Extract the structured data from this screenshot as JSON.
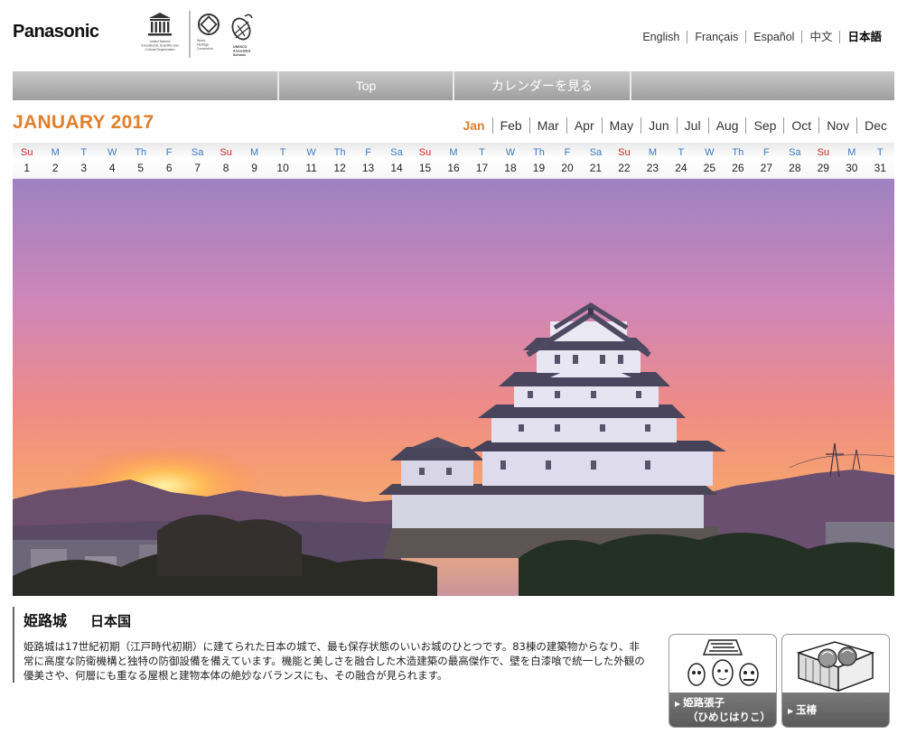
{
  "header": {
    "brand": "Panasonic",
    "unesco": {
      "line1": "United Nations",
      "line2": "Educational, Scientific and",
      "line3": "Cultural Organization",
      "whc1": "World",
      "whc2": "Heritage",
      "whc3": "Convention",
      "asp1": "UNESCO",
      "asp2": "Associated",
      "asp3": "Schools"
    },
    "languages": [
      "English",
      "Français",
      "Español",
      "中文",
      "日本語"
    ],
    "active_language": "日本語"
  },
  "nav": {
    "top_label": "Top",
    "calendar_label": "カレンダーを見る"
  },
  "calendar": {
    "title": "JANUARY 2017",
    "months": [
      "Jan",
      "Feb",
      "Mar",
      "Apr",
      "May",
      "Jun",
      "Jul",
      "Aug",
      "Sep",
      "Oct",
      "Nov",
      "Dec"
    ],
    "active_month": "Jan",
    "weekdays": [
      "Su",
      "M",
      "T",
      "W",
      "Th",
      "F",
      "Sa",
      "Su",
      "M",
      "T",
      "W",
      "Th",
      "F",
      "Sa",
      "Su",
      "M",
      "T",
      "W",
      "Th",
      "F",
      "Sa",
      "Su",
      "M",
      "T",
      "W",
      "Th",
      "F",
      "Sa",
      "Su",
      "M",
      "T"
    ],
    "dates": [
      "1",
      "2",
      "3",
      "4",
      "5",
      "6",
      "7",
      "8",
      "9",
      "10",
      "11",
      "12",
      "13",
      "14",
      "15",
      "16",
      "17",
      "18",
      "19",
      "20",
      "21",
      "22",
      "23",
      "24",
      "25",
      "26",
      "27",
      "28",
      "29",
      "30",
      "31"
    ]
  },
  "caption": {
    "title": "姫路城",
    "country": "日本国",
    "text": "姫路城は17世紀初期（江戸時代初期）に建てられた日本の城で、最も保存状態のいいお城のひとつです。83棟の建築物からなり、非常に高度な防衛機構と独特の防御設備を備えています。機能と美しさを融合した木造建築の最高傑作で、壁を白漆喰で統一した外観の優美さや、何層にも重なる屋根と建物本体の絶妙なバランスにも、その融合が見られます。"
  },
  "thumbnails": [
    {
      "label_line1": "姫路張子",
      "label_line2": "（ひめじはりこ）",
      "icon": "papier-mache-masks-icon"
    },
    {
      "label_line1": "玉椿",
      "label_line2": "",
      "icon": "tamatsubaki-sweets-icon"
    }
  ],
  "colors": {
    "accent": "#e07f2c",
    "weekday": "#3a79c2",
    "sunday": "#cc2222",
    "nav_gray": "#b0b0b0"
  }
}
